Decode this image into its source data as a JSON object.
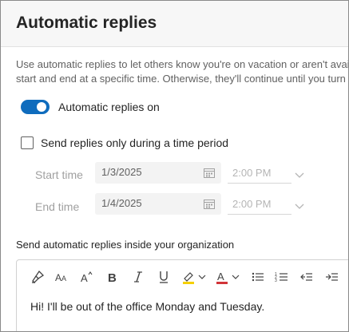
{
  "dialog": {
    "title": "Automatic replies",
    "description_line1": "Use automatic replies to let others know you're on vacation or aren't available",
    "description_line2": "start and end at a specific time. Otherwise, they'll continue until you turn the"
  },
  "toggle": {
    "label": "Automatic replies on",
    "on": true
  },
  "time_period": {
    "checkbox_label": "Send replies only during a time period",
    "checked": false,
    "start_label": "Start time",
    "start_date": "1/3/2025",
    "start_time": "2:00 PM",
    "end_label": "End time",
    "end_date": "1/4/2025",
    "end_time": "2:00 PM"
  },
  "inside_org": {
    "label": "Send automatic replies inside your organization",
    "message": "Hi! I'll be out of the office Monday and Tuesday."
  },
  "toolbar": {
    "icons": [
      "format-painter-icon",
      "font-size-icon",
      "grow-font-icon",
      "bold-icon",
      "italic-icon",
      "underline-icon",
      "highlight-icon",
      "font-color-icon",
      "bullets-icon",
      "numbering-icon",
      "decrease-indent-icon",
      "increase-indent-icon"
    ],
    "highlight_color": "#f5d000",
    "font_color": "#d13438"
  },
  "colors": {
    "accent": "#0f6cbd"
  }
}
